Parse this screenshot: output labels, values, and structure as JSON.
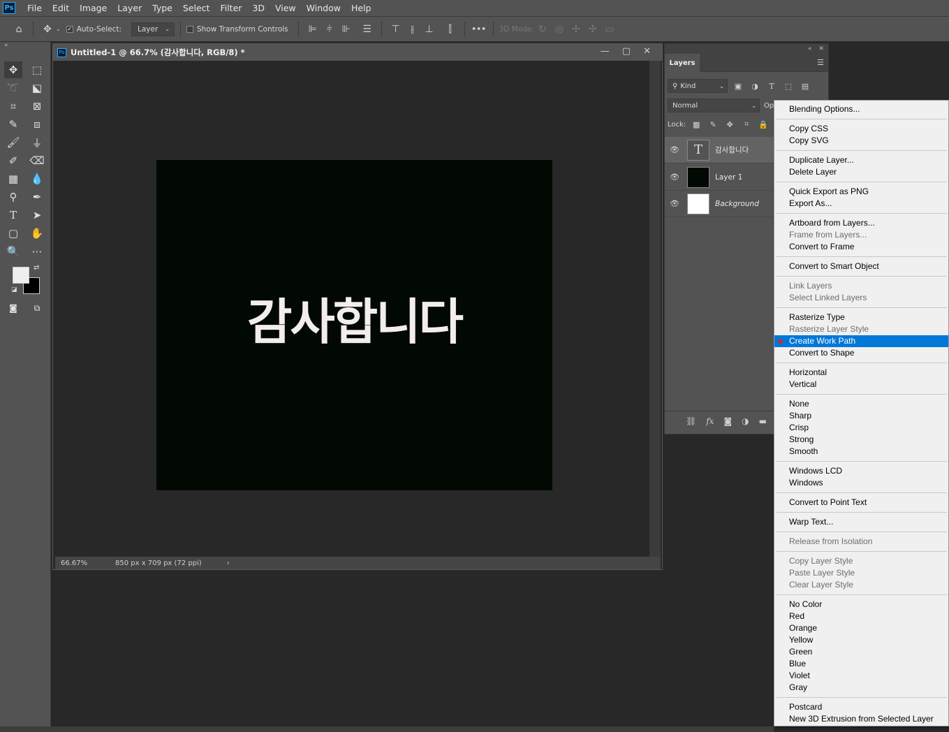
{
  "menubar": {
    "logo": "Ps",
    "items": [
      "File",
      "Edit",
      "Image",
      "Layer",
      "Type",
      "Select",
      "Filter",
      "3D",
      "View",
      "Window",
      "Help"
    ]
  },
  "options": {
    "auto_select_label": "Auto-Select:",
    "auto_select_value": "Layer",
    "show_transform_label": "Show Transform Controls",
    "mode_3d_label": "3D Mode:",
    "more_label": "•••"
  },
  "document": {
    "title": "Untitled-1 @ 66.7% (감사합니다, RGB/8) *",
    "canvas_text": "감사합니다",
    "zoom": "66.67%",
    "doc_info": "850 px x 709 px (72 ppi)"
  },
  "layers_panel": {
    "tab": "Layers",
    "kind_label": "Kind",
    "blend_mode": "Normal",
    "opacity_label": "Op",
    "lock_label": "Lock:",
    "layers": [
      {
        "name": "감사합니다",
        "thumb": "T",
        "selected": true
      },
      {
        "name": "Layer 1",
        "thumb": "",
        "selected": false
      },
      {
        "name": "Background",
        "thumb": "",
        "selected": false
      }
    ]
  },
  "context_menu": {
    "items": [
      {
        "label": "Blending Options...",
        "disabled": false
      },
      {
        "label": "Copy CSS",
        "disabled": false
      },
      {
        "label": "Copy SVG",
        "disabled": false
      },
      {
        "label": "Duplicate Layer...",
        "disabled": false
      },
      {
        "label": "Delete Layer",
        "disabled": false
      },
      {
        "label": "Quick Export as PNG",
        "disabled": false
      },
      {
        "label": "Export As...",
        "disabled": false
      },
      {
        "label": "Artboard from Layers...",
        "disabled": false
      },
      {
        "label": "Frame from Layers...",
        "disabled": true
      },
      {
        "label": "Convert to Frame",
        "disabled": false
      },
      {
        "label": "Convert to Smart Object",
        "disabled": false
      },
      {
        "label": "Link Layers",
        "disabled": true
      },
      {
        "label": "Select Linked Layers",
        "disabled": true
      },
      {
        "label": "Rasterize Type",
        "disabled": false
      },
      {
        "label": "Rasterize Layer Style",
        "disabled": true
      },
      {
        "label": "Create Work Path",
        "disabled": false,
        "highlight": true
      },
      {
        "label": "Convert to Shape",
        "disabled": false
      },
      {
        "label": "Horizontal",
        "disabled": false
      },
      {
        "label": "Vertical",
        "disabled": false
      },
      {
        "label": "None",
        "disabled": false
      },
      {
        "label": "Sharp",
        "disabled": false
      },
      {
        "label": "Crisp",
        "disabled": false
      },
      {
        "label": "Strong",
        "disabled": false
      },
      {
        "label": "Smooth",
        "disabled": false
      },
      {
        "label": "Windows LCD",
        "disabled": false
      },
      {
        "label": "Windows",
        "disabled": false
      },
      {
        "label": "Convert to Point Text",
        "disabled": false
      },
      {
        "label": "Warp Text...",
        "disabled": false
      },
      {
        "label": "Release from Isolation",
        "disabled": true
      },
      {
        "label": "Copy Layer Style",
        "disabled": true
      },
      {
        "label": "Paste Layer Style",
        "disabled": true
      },
      {
        "label": "Clear Layer Style",
        "disabled": true
      },
      {
        "label": "No Color",
        "disabled": false
      },
      {
        "label": "Red",
        "disabled": false
      },
      {
        "label": "Orange",
        "disabled": false
      },
      {
        "label": "Yellow",
        "disabled": false
      },
      {
        "label": "Green",
        "disabled": false
      },
      {
        "label": "Blue",
        "disabled": false
      },
      {
        "label": "Violet",
        "disabled": false
      },
      {
        "label": "Gray",
        "disabled": false
      },
      {
        "label": "Postcard",
        "disabled": false
      },
      {
        "label": "New 3D Extrusion from Selected Layer",
        "disabled": false
      }
    ]
  },
  "colors": {
    "accent": "#0078d7",
    "foreground": "#f0eeee",
    "background": "#000000"
  }
}
